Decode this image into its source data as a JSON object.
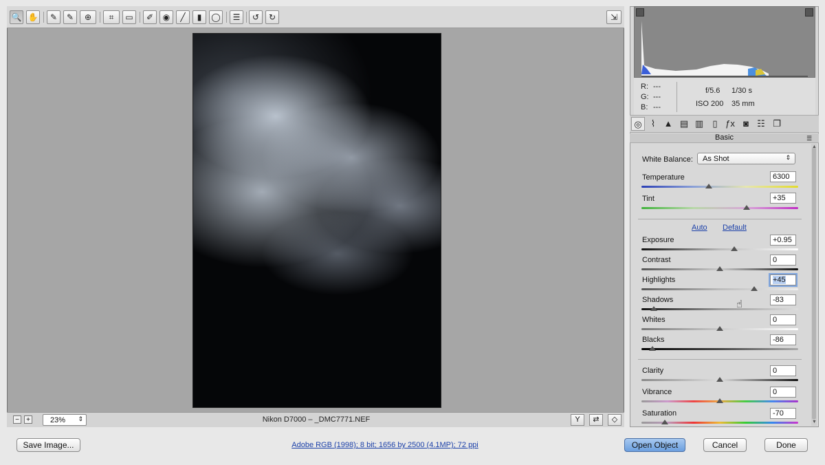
{
  "toolbar": {
    "tools": [
      {
        "name": "zoom-tool",
        "glyph": "🔍"
      },
      {
        "name": "hand-tool",
        "glyph": "✋"
      },
      {
        "name": "white-balance-tool",
        "glyph": "✎"
      },
      {
        "name": "color-sampler-tool",
        "glyph": "✎"
      },
      {
        "name": "targeted-adjustment-tool",
        "glyph": "⊕"
      },
      {
        "name": "crop-tool",
        "glyph": "⌗"
      },
      {
        "name": "straighten-tool",
        "glyph": "▭"
      },
      {
        "name": "spot-removal-tool",
        "glyph": "✐"
      },
      {
        "name": "red-eye-tool",
        "glyph": "◉"
      },
      {
        "name": "adjustment-brush-tool",
        "glyph": "╱"
      },
      {
        "name": "graduated-filter-tool",
        "glyph": "▮"
      },
      {
        "name": "radial-filter-tool",
        "glyph": "◯"
      },
      {
        "name": "preferences-tool",
        "glyph": "☰"
      },
      {
        "name": "rotate-left-tool",
        "glyph": "↺"
      },
      {
        "name": "rotate-right-tool",
        "glyph": "↻"
      }
    ],
    "fullscreen_glyph": "⇲"
  },
  "status": {
    "zoom": "23%",
    "zoom_out": "−",
    "zoom_in": "+",
    "file_title": "Nikon D7000  –  _DMC7771.NEF"
  },
  "readout": {
    "r_label": "R:",
    "r_val": "---",
    "g_label": "G:",
    "g_val": "---",
    "b_label": "B:",
    "b_val": "---",
    "aperture": "f/5.6",
    "shutter": "1/30 s",
    "iso": "ISO 200",
    "focal": "35 mm"
  },
  "panel": {
    "title": "Basic",
    "white_balance_label": "White Balance:",
    "white_balance_value": "As Shot",
    "auto_label": "Auto",
    "default_label": "Default",
    "sliders": [
      {
        "key": "temperature",
        "label": "Temperature",
        "value": "6300",
        "pos": 0.43
      },
      {
        "key": "tint",
        "label": "Tint",
        "value": "+35",
        "pos": 0.67
      },
      {
        "key": "exposure",
        "label": "Exposure",
        "value": "+0.95",
        "pos": 0.59
      },
      {
        "key": "contrast",
        "label": "Contrast",
        "value": "0",
        "pos": 0.5
      },
      {
        "key": "highlights",
        "label": "Highlights",
        "value": "+45",
        "pos": 0.72
      },
      {
        "key": "shadows",
        "label": "Shadows",
        "value": "-83",
        "pos": 0.08
      },
      {
        "key": "whites",
        "label": "Whites",
        "value": "0",
        "pos": 0.5
      },
      {
        "key": "blacks",
        "label": "Blacks",
        "value": "-86",
        "pos": 0.07
      },
      {
        "key": "clarity",
        "label": "Clarity",
        "value": "0",
        "pos": 0.5
      },
      {
        "key": "vibrance",
        "label": "Vibrance",
        "value": "0",
        "pos": 0.5
      },
      {
        "key": "saturation",
        "label": "Saturation",
        "value": "-70",
        "pos": 0.15
      }
    ]
  },
  "buttons": {
    "save_image": "Save Image...",
    "open_object": "Open Object",
    "cancel": "Cancel",
    "done": "Done"
  },
  "workflow_options": "Adobe RGB (1998); 8 bit; 1656 by 2500 (4.1MP); 72 ppi",
  "colors": {
    "accent": "#6b9fdf",
    "link": "#1a3fa8",
    "canvas_bg": "#a6a6a6"
  }
}
